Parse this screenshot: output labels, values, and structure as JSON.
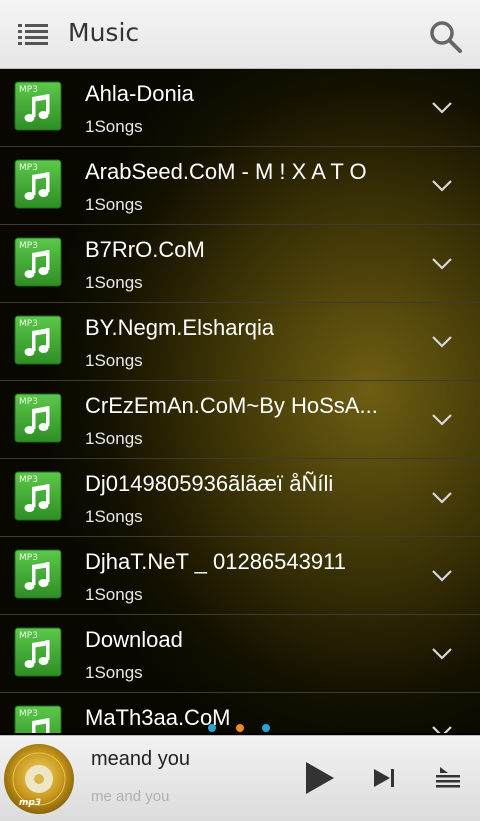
{
  "header": {
    "title": "Music",
    "menu_icon": "list-menu-icon",
    "search_icon": "search-icon"
  },
  "folders": [
    {
      "name": "Ahla-Donia",
      "count": "1Songs"
    },
    {
      "name": "ArabSeed.CoM - M ! X A T O",
      "count": "1Songs"
    },
    {
      "name": "B7RrO.CoM",
      "count": "1Songs"
    },
    {
      "name": "BY.Negm.Elsharqia",
      "count": "1Songs"
    },
    {
      "name": "CrEzEmAn.CoM~By HoSsA...",
      "count": "1Songs"
    },
    {
      "name": "Dj0149805936ãlãæï åÑíli",
      "count": "1Songs"
    },
    {
      "name": "DjhaT.NeT _ 01286543911",
      "count": "1Songs"
    },
    {
      "name": "Download",
      "count": "1Songs"
    },
    {
      "name": "MaTh3aa.CoM",
      "count": ""
    }
  ],
  "file_icon_label": "MP3",
  "now_playing": {
    "title": "meand you",
    "artist": "me and you",
    "album_label": "mp3"
  },
  "page_indicator": {
    "count": 3,
    "active_index": 1
  },
  "colors": {
    "accent_dot": "#29a3d6",
    "active_dot": "#f08a1c",
    "icon_green": "#3aa832"
  }
}
